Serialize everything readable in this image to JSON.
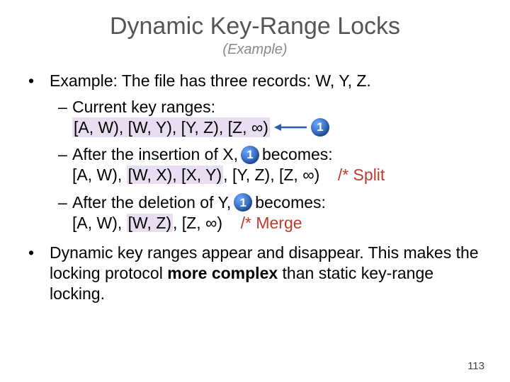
{
  "title": "Dynamic Key-Range Locks",
  "subtitle": "(Example)",
  "bullet1": "Example: The file has three records: W, Y, Z.",
  "sub1": {
    "dash": "–",
    "line1": "Current key ranges:",
    "ranges": "[A, W), [W, Y), [Y, Z), [Z, ∞)",
    "badge": "1"
  },
  "sub2": {
    "dash": "–",
    "pre": "After the insertion of X, ",
    "badge": "1",
    "post": " becomes:",
    "ranges_a": "[A, W), ",
    "ranges_hl": "[W, X), [X, Y)",
    "ranges_b": ", [Y, Z), [Z, ∞)",
    "comment": "/* Split"
  },
  "sub3": {
    "dash": "–",
    "pre": "After the deletion of Y, ",
    "badge": "1",
    "post": " becomes:",
    "ranges_a": "[A, W), ",
    "ranges_hl": "[W, Z)",
    "ranges_b": ", [Z, ∞)",
    "comment": "/* Merge"
  },
  "bullet2_a": "Dynamic key ranges appear and disappear. This makes the locking protocol ",
  "bullet2_strong": "more complex",
  "bullet2_b": " than static key-range locking.",
  "dot": "•",
  "pagenum": "113"
}
